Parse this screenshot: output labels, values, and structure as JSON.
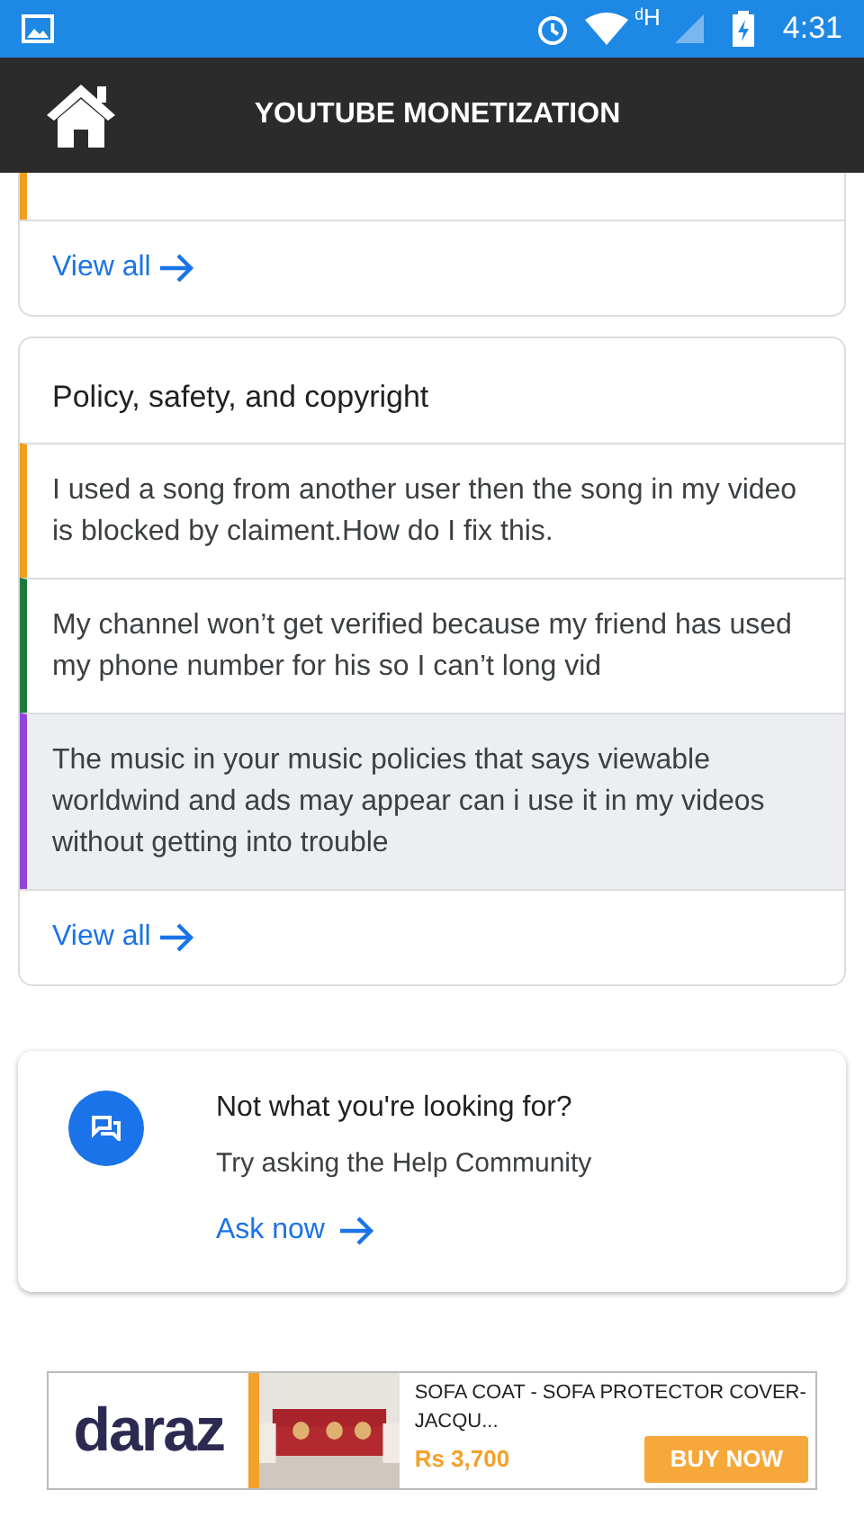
{
  "status_bar": {
    "network": "ᵈH",
    "time": "4:31"
  },
  "header": {
    "title": "YOUTUBE MONETIZATION"
  },
  "cards": [
    {
      "items": [
        {
          "color": "#f0a020",
          "selected": false
        }
      ],
      "link": "View all"
    },
    {
      "title": "Policy, safety, and copyright",
      "items": [
        {
          "text": "I used a song from another user then the song in my video is blocked by claiment.How do I fix this.",
          "color": "#f0a020",
          "selected": false
        },
        {
          "text": "My channel won’t get verified because my friend has used my phone number for his so I can’t long vid",
          "color": "#1e7a3c",
          "selected": false
        },
        {
          "text": "The music in your music policies that says viewable worldwind and ads may appear can i use it in my videos without getting into trouble",
          "color": "#8e44d8",
          "selected": true
        }
      ],
      "link": "View all"
    }
  ],
  "help": {
    "title": "Not what you're looking for?",
    "subtitle": "Try asking the Help Community",
    "link": "Ask now"
  },
  "ad": {
    "brand": "daraz",
    "product": "SOFA COAT - SOFA PROTECTOR COVER-JACQU...",
    "price": "Rs 3,700",
    "button": "BUY NOW"
  }
}
